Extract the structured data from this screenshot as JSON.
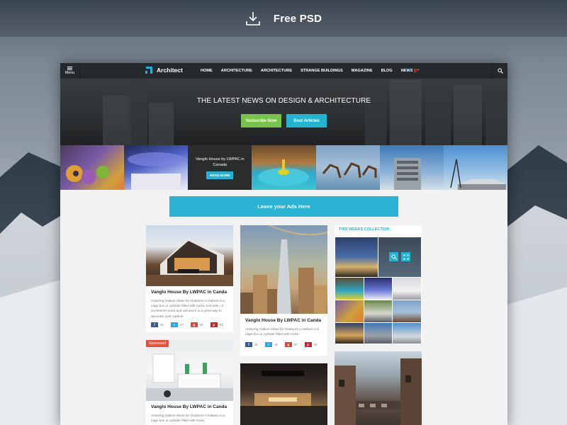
{
  "banner": {
    "download_text": "Free PSD"
  },
  "navbar": {
    "menu_label": "Menu",
    "logo_text": "Architect",
    "links": [
      "HOME",
      "ARCHITECTURE",
      "ARCHITECTURE",
      "STRANGE BUILDINGS",
      "MAGAZINE",
      "BLOG",
      "NEWS"
    ],
    "social": {
      "twitter": "t",
      "facebook": "f",
      "googleplus": "g+"
    }
  },
  "hero": {
    "title": "THE LATEST NEWS ON DESIGN & ARCHITECTURE",
    "subscribe_label": "Subscribe Now",
    "best_label": "Best Articles"
  },
  "strip": {
    "featured_title": "Vanglo House by LWPAC in Canada",
    "featured_button": "READ MORE"
  },
  "ad": {
    "text": "Leave your Ads Here"
  },
  "cards": [
    {
      "title": "Vanglo House By LWPAC in Canda",
      "text": "Amazing Gabion Ideas for Outdoors A Gabion is a cage box or cylinder filled with rocks, concrete, or sometimes sand and soil and it is a great way to decorate your outdoor",
      "shares": {
        "facebook": "31",
        "twitter": "17",
        "googleplus": "37",
        "pinterest": "03"
      }
    },
    {
      "title": "Vanglo House By LWPAC in Canda",
      "text": "Amazing Gabion Ideas for Outdoors A Gabion is a cage box or cylinder filled with rocks",
      "shares": {
        "facebook": "31",
        "twitter": "12",
        "googleplus": "37",
        "pinterest": "02"
      }
    },
    {
      "sponsored": "Sponsored",
      "title": "Vanglo House By LWPAC in Canda",
      "text": "Amazing Gabion Ideas for Outdoors A Gabion is a cage box or cylinder filled with rocks,"
    }
  ],
  "collection": {
    "title": "THIS WEEKS COLLECTION"
  },
  "colors": {
    "accent": "#23b4d2",
    "green": "#79c34d",
    "navbar": "#25292c",
    "sponsored": "#e4543c"
  },
  "icons": [
    "download-icon",
    "menu-icon",
    "logo-icon",
    "twitter-icon",
    "facebook-icon",
    "googleplus-icon",
    "search-icon",
    "zoom-icon",
    "expand-icon",
    "pinterest-icon"
  ]
}
